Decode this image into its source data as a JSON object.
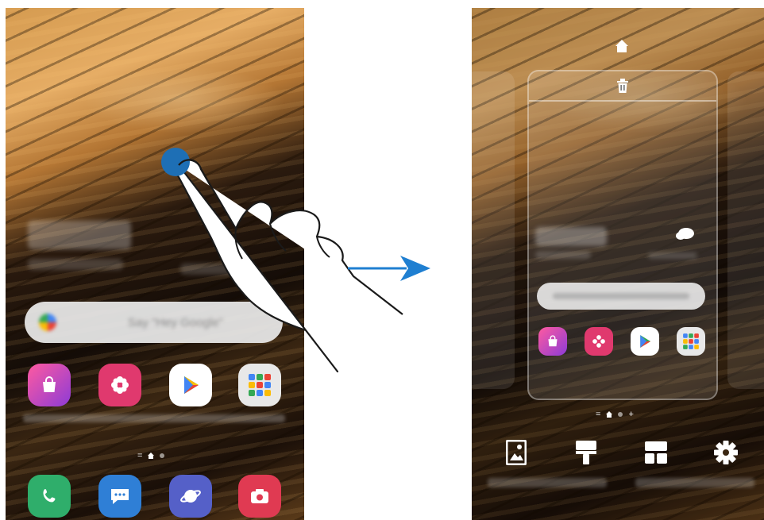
{
  "left_screen": {
    "search_placeholder": "Say \"Hey Google\"",
    "apps_row": [
      {
        "name": "Galaxy Store",
        "icon": "shopping-bag-icon",
        "color": "#d63fae"
      },
      {
        "name": "Gallery",
        "icon": "flower-icon",
        "color": "#e0396e"
      },
      {
        "name": "Play Store",
        "icon": "play-triangle-icon",
        "color": "#ffffff"
      },
      {
        "name": "Google",
        "icon": "folder-grid-icon",
        "color": "#e8e8e8"
      }
    ],
    "dock": [
      {
        "name": "Phone",
        "icon": "phone-icon",
        "color": "#2fae6b"
      },
      {
        "name": "Messages",
        "icon": "chat-bubble-icon",
        "color": "#2f7fd6"
      },
      {
        "name": "Internet",
        "icon": "planet-icon",
        "color": "#5560c8"
      },
      {
        "name": "Camera",
        "icon": "camera-icon",
        "color": "#e03a52"
      }
    ],
    "page_indicator": "="
  },
  "right_screen": {
    "page_indicator_prefix": "=",
    "page_indicator_suffix": "+",
    "top_icons": [
      "home-icon",
      "trash-icon"
    ],
    "bottom_options": [
      {
        "name": "Wallpapers",
        "icon": "wallpaper-icon"
      },
      {
        "name": "Themes",
        "icon": "paintbrush-icon"
      },
      {
        "name": "Widgets",
        "icon": "widgets-icon"
      },
      {
        "name": "Home screen settings",
        "icon": "gear-icon"
      }
    ]
  },
  "colors": {
    "touch_point": "#1e6fb5",
    "arrow": "#1f7fd1"
  }
}
